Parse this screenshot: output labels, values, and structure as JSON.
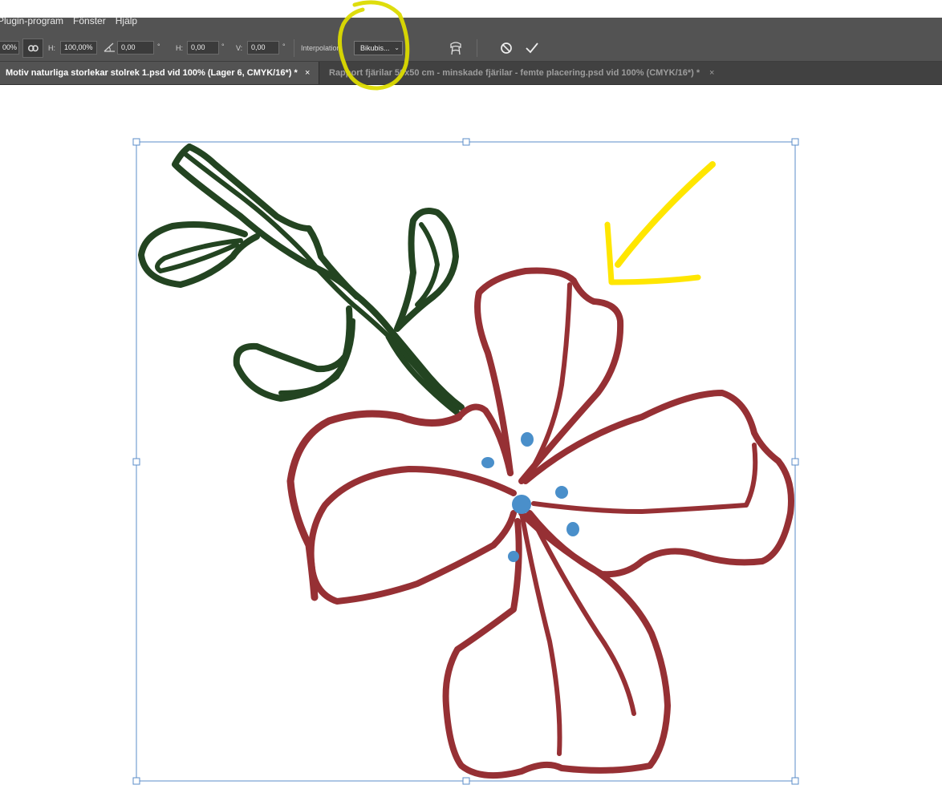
{
  "menu": {
    "items": [
      "Plugin-program",
      "Fönster",
      "Hjälp"
    ]
  },
  "options": {
    "width_value": "00%",
    "height_label": "H:",
    "height_value": "100,00%",
    "angle_value": "0,00",
    "hskew_label": "H:",
    "hskew_value": "0,00",
    "vskew_label": "V:",
    "vskew_value": "0,00",
    "degree_symbol": "°",
    "interpolation_label": "Interpolation:",
    "interpolation_value": "Bikubis..."
  },
  "tabs": [
    {
      "label": "Motiv naturliga storlekar stolrek 1.psd vid 100% (Lager 6, CMYK/16*) *",
      "active": true
    },
    {
      "label": "Rapport fjärilar 50x50 cm - minskade fjärilar - femte placering.psd vid 100% (CMYK/16*) *",
      "active": false
    }
  ],
  "tab_close_glyph": "×",
  "icons": {
    "link": "link-icon",
    "angle": "angle-icon",
    "warp": "warp-icon",
    "cancel": "cancel-icon",
    "commit": "checkmark-icon"
  },
  "colors": {
    "ui_dark": "#535353",
    "tab_bar": "#414141",
    "stem_green": "#234421",
    "petal_red": "#963034",
    "stamen_blue": "#4a8fca",
    "transform_blue": "#5b8cc9",
    "annotation_yellow": "#ffe600",
    "annotation_olive": "#dcdb00"
  }
}
